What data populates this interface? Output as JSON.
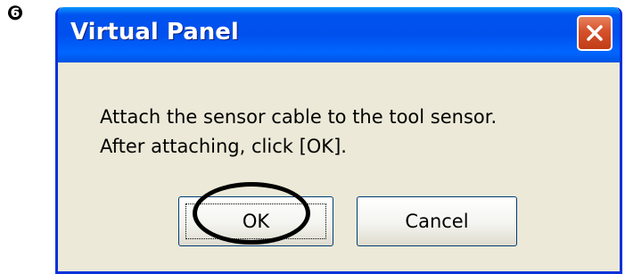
{
  "step_marker": "❻",
  "window": {
    "title": "Virtual Panel",
    "close_icon": "close-x-icon"
  },
  "message": {
    "line1": "Attach the sensor cable to the tool sensor.",
    "line2": "After attaching, click [OK]."
  },
  "buttons": {
    "ok_label": "OK",
    "cancel_label": "Cancel"
  },
  "colors": {
    "titlebar": "#0053ee",
    "dialog_background": "#ece9d8",
    "close_button": "#d5512a"
  }
}
